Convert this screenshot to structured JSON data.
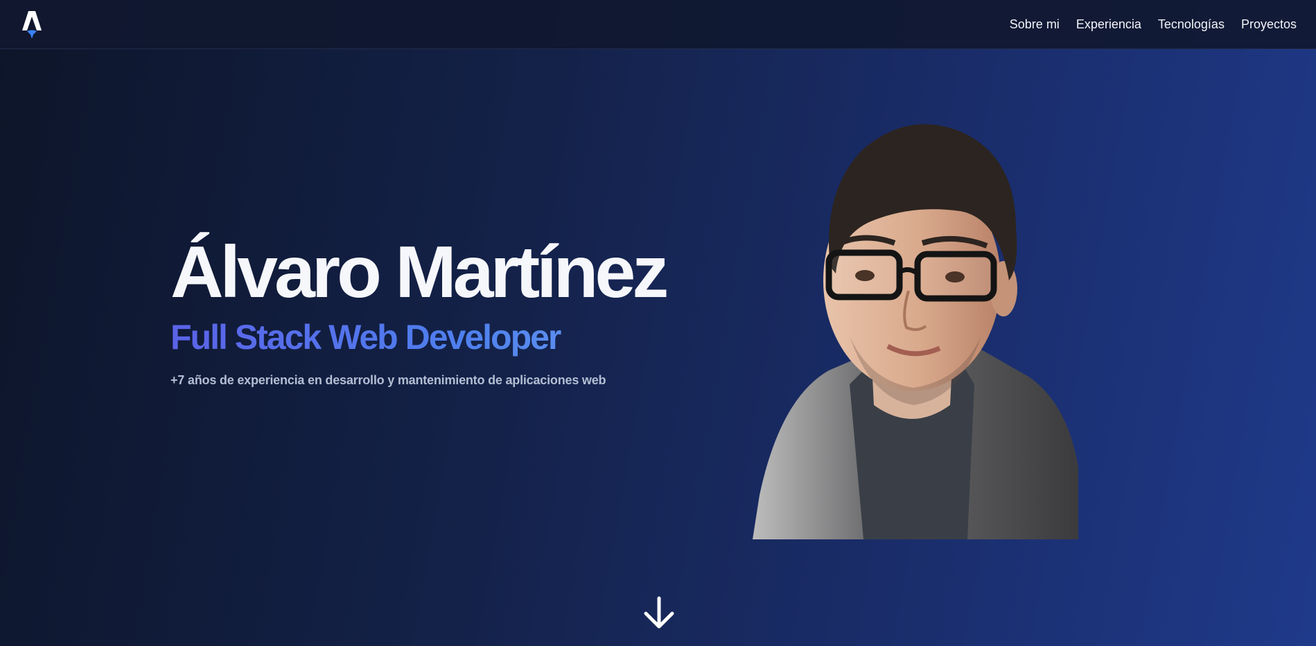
{
  "header": {
    "logo_icon": "astro-logo-icon",
    "nav": [
      {
        "label": "Sobre mi"
      },
      {
        "label": "Experiencia"
      },
      {
        "label": "Tecnologías"
      },
      {
        "label": "Proyectos"
      }
    ]
  },
  "hero": {
    "name": "Álvaro Martínez",
    "role": "Full Stack Web Developer",
    "description": "+7 años de experiencia en desarrollo y mantenimiento de aplicaciones web",
    "portrait_icon": "profile-photo",
    "scroll_icon": "arrow-down-icon"
  },
  "colors": {
    "background_start": "#0d1529",
    "background_end": "#1f3a8a",
    "role_gradient_start": "#5b63e8",
    "role_gradient_end": "#6fa3f0",
    "text": "#f6f7fb",
    "muted_text": "#b3bdd3"
  }
}
